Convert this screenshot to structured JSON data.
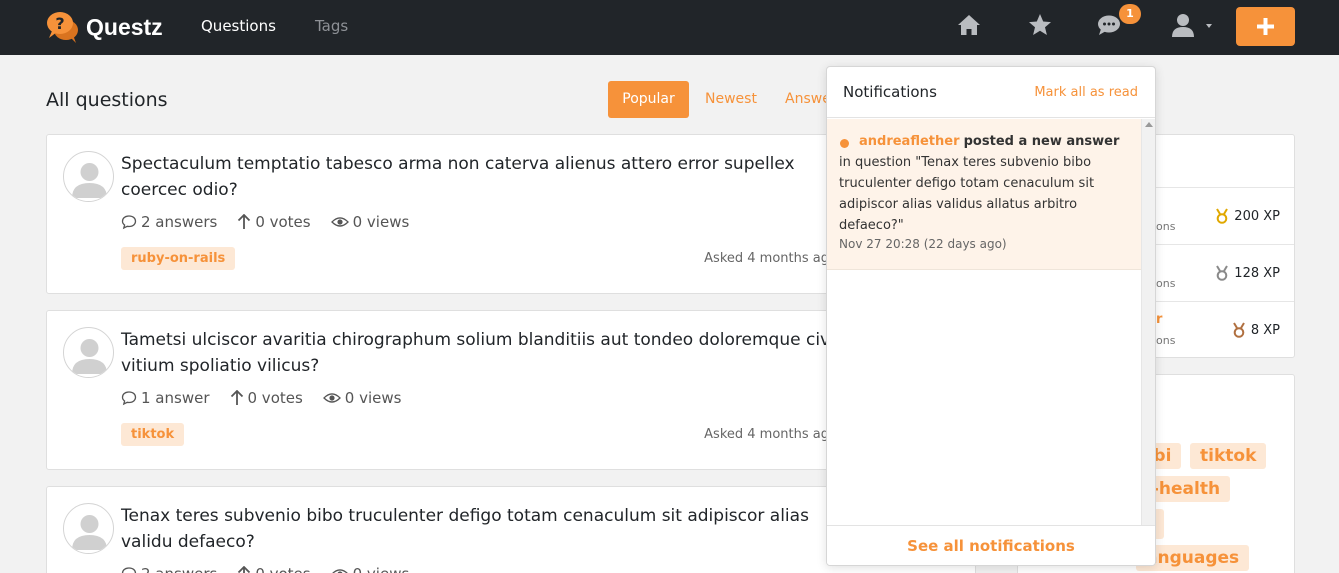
{
  "brand": {
    "name": "Questz",
    "accent": "#f6923a",
    "navbar_bg": "#212529"
  },
  "nav": {
    "questions": "Questions",
    "tags": "Tags",
    "notification_count": "1",
    "icons": [
      "home-icon",
      "star-icon",
      "chat-icon",
      "user-icon",
      "plus-icon"
    ]
  },
  "main": {
    "title": "All questions",
    "sort": {
      "popular": "Popular",
      "newest": "Newest",
      "answered": "Answe"
    },
    "questions": [
      {
        "title": "Spectaculum temptatio tabesco arma non caterva alienus attero error supellex coercec odio?",
        "answers": "2 answers",
        "votes": "0 votes",
        "views": "0 views",
        "tag": "ruby-on-rails",
        "asked": "Asked 4 months ag"
      },
      {
        "title": "Tametsi ulciscor avaritia chirographum solium blanditiis aut tondeo doloremque civitas vitium spoliatio vilicus?",
        "answers": "1 answer",
        "votes": "0 votes",
        "views": "0 views",
        "tag": "tiktok",
        "asked": "Asked 4 months ag"
      },
      {
        "title": "Tenax teres subvenio bibo truculenter defigo totam cenaculum sit adipiscor alias validu defaeco?",
        "answers": "2 answers",
        "votes": "0 votes",
        "views": "0 views",
        "tag": "",
        "asked": ""
      }
    ]
  },
  "sidebar": {
    "leaders": [
      {
        "name": "",
        "ons": "ons",
        "xp": "200 XP",
        "medal_color": "#e0a800"
      },
      {
        "name": "",
        "ons": "ons",
        "xp": "128 XP",
        "medal_color": "#8a8a8a"
      },
      {
        "name": "r",
        "ons": "ons",
        "xp": "8 XP",
        "medal_color": "#b07040"
      }
    ],
    "tags": [
      "fbi",
      "tiktok",
      "l-health",
      "anguages"
    ]
  },
  "notifications": {
    "title": "Notifications",
    "mark_all": "Mark all as read",
    "items": [
      {
        "user": "andreaflether",
        "action": "posted a new answer",
        "text": "in question \"Tenax teres subvenio bibo truculenter defigo totam cenaculum sit adipiscor alias validus allatus arbitro defaeco?\"",
        "time": "Nov 27 20:28 (22 days ago)"
      }
    ],
    "see_all": "See all notifications"
  }
}
